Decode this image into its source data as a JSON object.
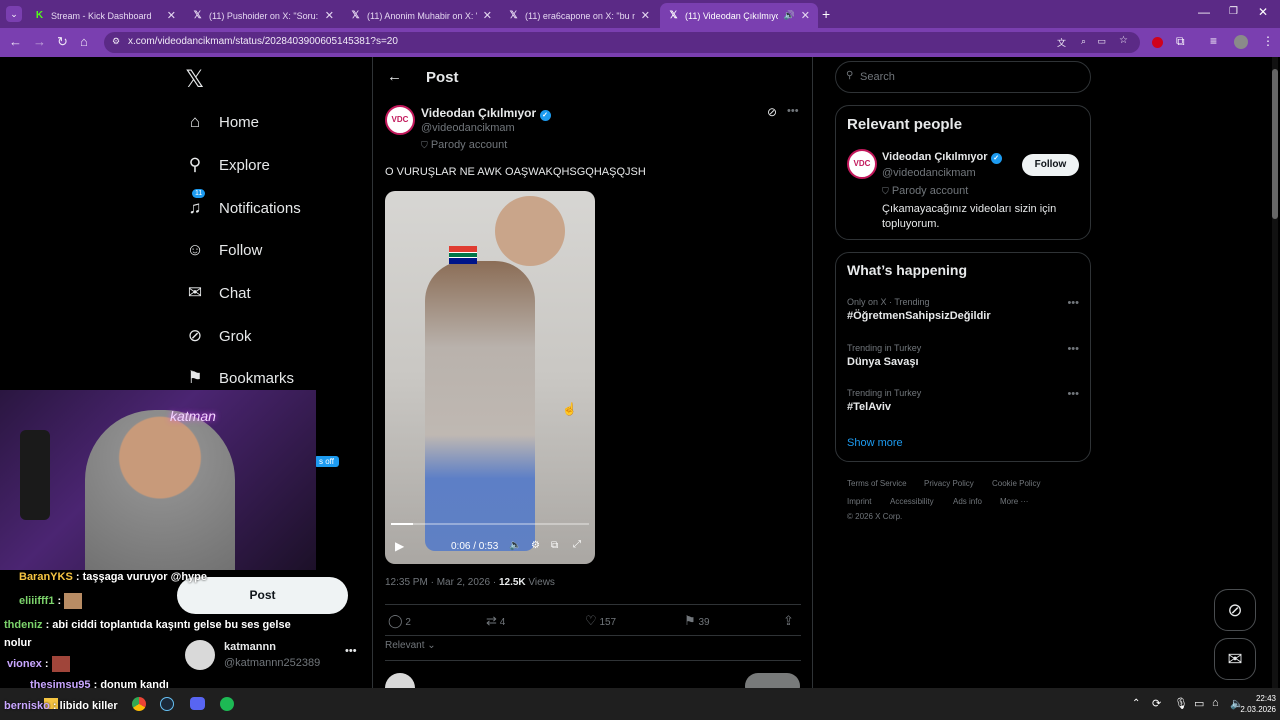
{
  "browser": {
    "tabs": [
      {
        "title": "Stream - Kick Dashboard",
        "icon": "kick-icon"
      },
      {
        "title": "(11) Pushoider on X: \"Soru: \"Fe",
        "icon": "x-logo-icon"
      },
      {
        "title": "(11) Anonim Muhabir on X: \"M",
        "icon": "x-logo-icon"
      },
      {
        "title": "(11) era6capone on X: \"bu ne a",
        "icon": "x-logo-icon"
      },
      {
        "title": "(11) Videodan Çıkılmıyor o",
        "icon": "x-logo-icon",
        "active": true
      }
    ],
    "url": "x.com/videodancikmam/status/2028403900605145381?s=20"
  },
  "sidebar": {
    "items": [
      {
        "label": "Home",
        "icon": "home-icon"
      },
      {
        "label": "Explore",
        "icon": "search-icon"
      },
      {
        "label": "Notifications",
        "icon": "bell-icon",
        "badge": "11"
      },
      {
        "label": "Follow",
        "icon": "person-add-icon"
      },
      {
        "label": "Chat",
        "icon": "mail-icon"
      },
      {
        "label": "Grok",
        "icon": "grok-icon"
      },
      {
        "label": "Bookmarks",
        "icon": "bookmark-icon"
      }
    ],
    "post_button": "Post",
    "account": {
      "name": "katmannn",
      "handle": "@katmannn252389"
    },
    "partial_badge": "s off"
  },
  "main": {
    "header_title": "Post",
    "author": {
      "name": "Videodan Çıkılmıyor",
      "handle": "@videodancikmam",
      "label": "Parody account",
      "avatar_text": "VDC"
    },
    "text": "O VURUŞLAR NE AWK OAŞWAKQHSGQHAŞQJSH",
    "video": {
      "time": "0:06 / 0:53",
      "progress": 0.113
    },
    "meta": {
      "time": "12:35 PM · Mar 2, 2026 · ",
      "views_count": "12.5K",
      "views_label": " Views"
    },
    "actions": {
      "replies": "2",
      "reposts": "4",
      "likes": "157",
      "bookmarks": "39"
    },
    "sort_label": "Relevant"
  },
  "right": {
    "search_placeholder": "Search",
    "relevant_title": "Relevant people",
    "person": {
      "name": "Videodan Çıkılmıyor",
      "handle": "@videodancikmam",
      "label": "Parody account",
      "bio": "Çıkamayacağınız videoları sizin için topluyorum.",
      "follow": "Follow",
      "avatar_text": "VDC"
    },
    "happening_title": "What’s happening",
    "trends": [
      {
        "context": "Only on X · Trending",
        "name": "#ÖğretmenSahipsizDeğildir"
      },
      {
        "context": "Trending in Turkey",
        "name": "Dünya Savaşı"
      },
      {
        "context": "Trending in Turkey",
        "name": "#TelAviv"
      }
    ],
    "show_more": "Show more",
    "footer": [
      "Terms of Service",
      "Privacy Policy",
      "Cookie Policy",
      "Imprint",
      "Accessibility",
      "Ads info",
      "More ···",
      "© 2026 X Corp."
    ]
  },
  "overlay": {
    "chat": [
      {
        "user": "BaranYKS",
        "msg": ": taşşaga vuruyor @hype",
        "color": "#f5c542"
      },
      {
        "user": "eliiifff1",
        "msg": ":",
        "color": "#7cd36b"
      },
      {
        "user": "thdeniz",
        "msg": ": abi ciddi toplantıda kaşıntı gelse bu ses gelse nolur",
        "color": "#7cd36b"
      },
      {
        "user": "vionex",
        "msg": ":",
        "color": "#c9a7ff"
      },
      {
        "user": "thesimsu95",
        "msg": ": donum kandı",
        "color": "#c9a7ff"
      },
      {
        "user": "bernisko",
        "msg": ": libido killer",
        "color": "#c9a7ff"
      }
    ]
  },
  "taskbar": {
    "time": "22:43",
    "date": "2.03.2026"
  }
}
